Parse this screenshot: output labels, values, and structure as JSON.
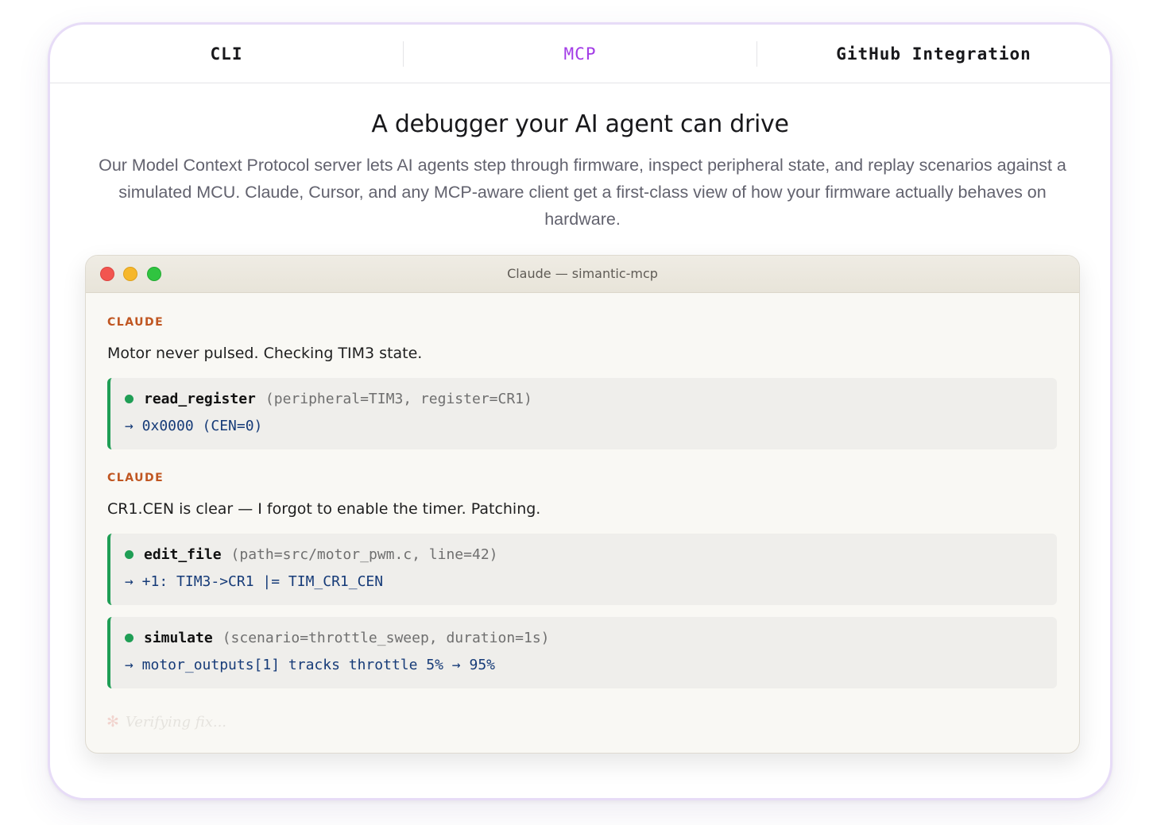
{
  "tabs": [
    {
      "label": "CLI",
      "active": false
    },
    {
      "label": "MCP",
      "active": true
    },
    {
      "label": "GitHub Integration",
      "active": false
    }
  ],
  "hero": {
    "title": "A debugger your AI agent can drive",
    "description": "Our Model Context Protocol server lets AI agents step through firmware, inspect peripheral state, and replay scenarios against a simulated MCU. Claude, Cursor, and any MCP-aware client get a first-class view of how your firmware actually behaves on hardware."
  },
  "window": {
    "title": "Claude — simantic-mcp"
  },
  "transcript": {
    "block1": {
      "speaker": "CLAUDE",
      "message": "Motor never pulsed. Checking TIM3 state.",
      "tool": {
        "name": "read_register",
        "args": "(peripheral=TIM3, register=CR1)",
        "result": "→ 0x0000 (CEN=0)"
      }
    },
    "block2": {
      "speaker": "CLAUDE",
      "message": "CR1.CEN is clear — I forgot to enable the timer. Patching.",
      "tool1": {
        "name": "edit_file",
        "args": "(path=src/motor_pwm.c, line=42)",
        "result": "→ +1: TIM3->CR1 |= TIM_CR1_CEN"
      },
      "tool2": {
        "name": "simulate",
        "args": "(scenario=throttle_sweep, duration=1s)",
        "result": "→ motor_outputs[1] tracks throttle 5% → 95%"
      }
    },
    "status": {
      "icon": "spinner-asterisk-icon",
      "glyph": "✻",
      "text": "Verifying fix..."
    }
  },
  "colors": {
    "active_tab": "#a23be6",
    "speaker": "#c05621",
    "tool_accent": "#1f9e55",
    "result_text": "#163b78"
  }
}
